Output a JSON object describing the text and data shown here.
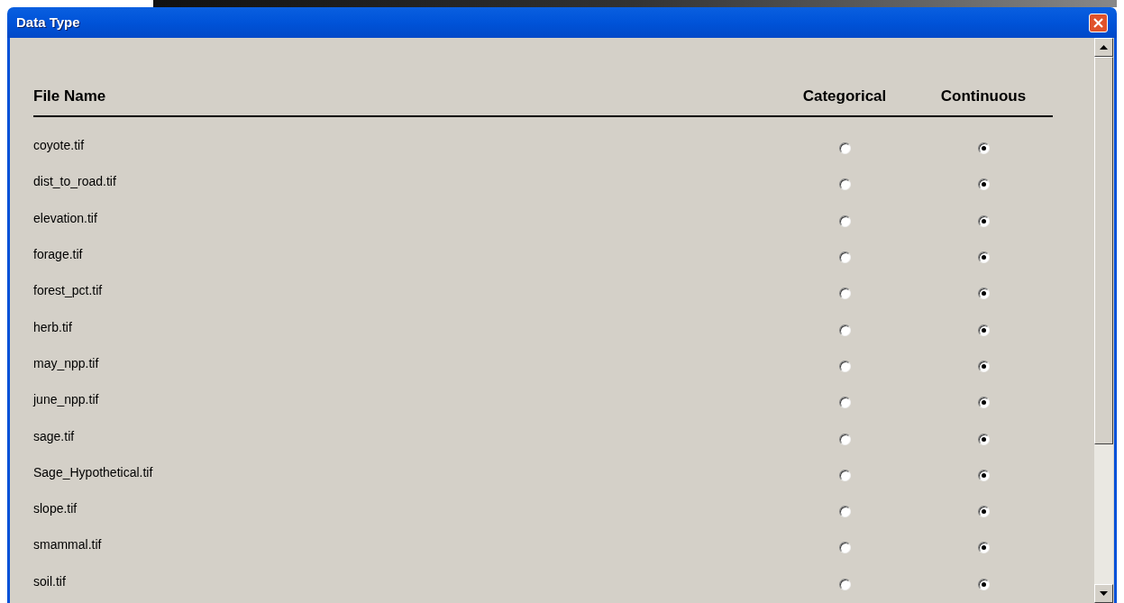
{
  "window": {
    "title": "Data Type"
  },
  "table": {
    "columns": [
      "File Name",
      "Categorical",
      "Continuous"
    ],
    "rows": [
      {
        "name": "coyote.tif",
        "choices": [
          {
            "selected": false
          },
          {
            "selected": true
          }
        ]
      },
      {
        "name": "dist_to_road.tif",
        "choices": [
          {
            "selected": false
          },
          {
            "selected": true
          }
        ]
      },
      {
        "name": "elevation.tif",
        "choices": [
          {
            "selected": false
          },
          {
            "selected": true
          }
        ]
      },
      {
        "name": "forage.tif",
        "choices": [
          {
            "selected": false
          },
          {
            "selected": true
          }
        ]
      },
      {
        "name": "forest_pct.tif",
        "choices": [
          {
            "selected": false
          },
          {
            "selected": true
          }
        ]
      },
      {
        "name": "herb.tif",
        "choices": [
          {
            "selected": false
          },
          {
            "selected": true
          }
        ]
      },
      {
        "name": "may_npp.tif",
        "choices": [
          {
            "selected": false
          },
          {
            "selected": true
          }
        ]
      },
      {
        "name": "june_npp.tif",
        "choices": [
          {
            "selected": false
          },
          {
            "selected": true
          }
        ]
      },
      {
        "name": "sage.tif",
        "choices": [
          {
            "selected": false
          },
          {
            "selected": true
          }
        ]
      },
      {
        "name": "Sage_Hypothetical.tif",
        "choices": [
          {
            "selected": false
          },
          {
            "selected": true
          }
        ]
      },
      {
        "name": "slope.tif",
        "choices": [
          {
            "selected": false
          },
          {
            "selected": true
          }
        ]
      },
      {
        "name": "smammal.tif",
        "choices": [
          {
            "selected": false
          },
          {
            "selected": true
          }
        ]
      },
      {
        "name": "soil.tif",
        "choices": [
          {
            "selected": false
          },
          {
            "selected": true
          }
        ]
      }
    ]
  }
}
